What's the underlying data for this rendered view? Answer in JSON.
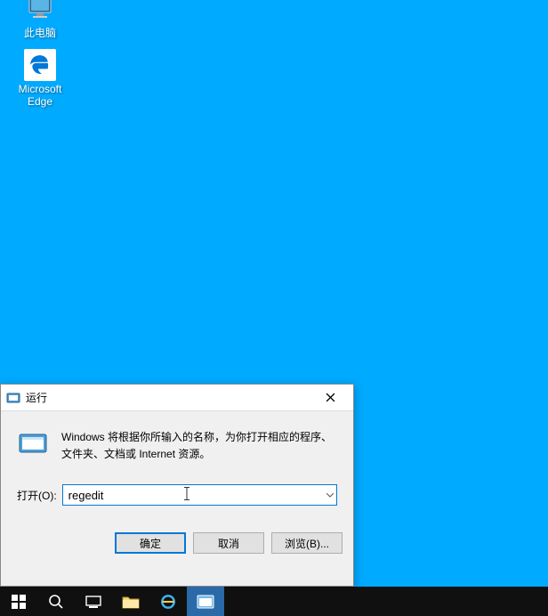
{
  "desktop": {
    "this_pc_label": "此电脑",
    "edge_label": "Microsoft\nEdge"
  },
  "run_dialog": {
    "title": "运行",
    "description": "Windows 将根据你所输入的名称，为你打开相应的程序、文件夹、文档或 Internet 资源。",
    "open_label": "打开(O):",
    "input_value": "regedit",
    "ok_button": "确定",
    "cancel_button": "取消",
    "browse_button": "浏览(B)..."
  }
}
